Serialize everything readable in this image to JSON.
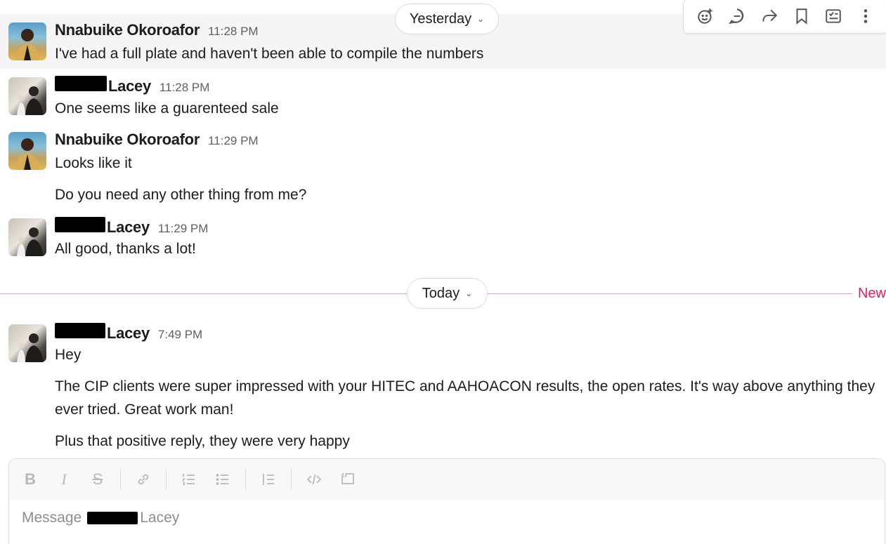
{
  "dividers": {
    "yesterday": {
      "label": "Yesterday"
    },
    "today": {
      "label": "Today",
      "new_label": "New"
    }
  },
  "messages": [
    {
      "sender": "Nnabuike Okoroafor",
      "time": "11:28 PM",
      "lines": [
        "I've had a full plate and haven't been able to compile the numbers"
      ]
    },
    {
      "sender": "Lacey",
      "time": "11:28 PM",
      "lines": [
        "One seems like a guarenteed sale"
      ]
    },
    {
      "sender": "Nnabuike Okoroafor",
      "time": "11:29 PM",
      "lines": [
        "Looks like it",
        "Do you need any other thing from me?"
      ]
    },
    {
      "sender": "Lacey",
      "time": "11:29 PM",
      "lines": [
        "All good, thanks a lot!"
      ]
    },
    {
      "sender": "Lacey",
      "time": "7:49 PM",
      "lines": [
        "Hey",
        "The CIP clients were super impressed with your HITEC and AAHOACON results, the open rates. It's way above anything they ever tried. Great work man!",
        "Plus that positive reply, they were very happy"
      ]
    }
  ],
  "message_actions": [
    "add-reaction-icon",
    "reply-in-thread-icon",
    "forward-icon",
    "bookmark-icon",
    "add-to-list-icon",
    "more-actions-icon"
  ],
  "composer": {
    "placeholder_prefix": "Message",
    "placeholder_name": "Lacey",
    "formatting": [
      "B",
      "I",
      "S"
    ]
  },
  "colors": {
    "new_divider": "#e01e5a",
    "divider_line": "#c9a9c9",
    "highlight_row": "#f5f5f5"
  }
}
